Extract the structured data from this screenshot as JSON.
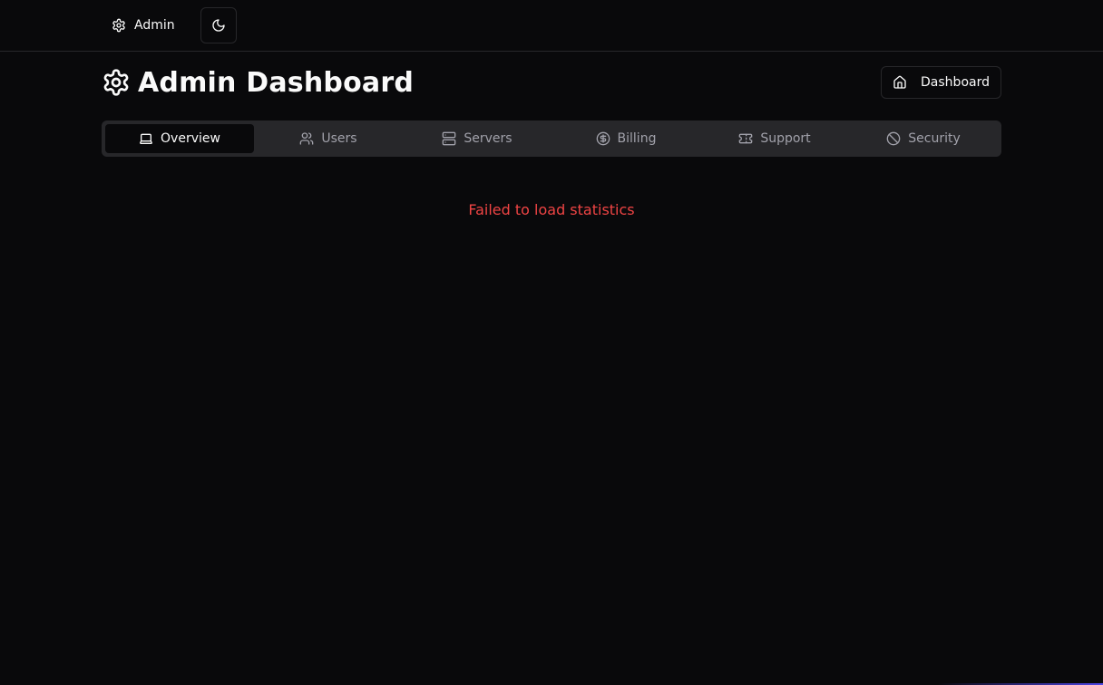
{
  "topbar": {
    "admin_label": "Admin",
    "admin_icon": "gear-icon",
    "theme_icon": "moon-icon"
  },
  "header": {
    "title": "Admin Dashboard",
    "title_icon": "gear-icon",
    "dashboard_button": "Dashboard",
    "dashboard_icon": "home-icon"
  },
  "tabs": [
    {
      "label": "Overview",
      "icon": "laptop-icon",
      "active": true
    },
    {
      "label": "Users",
      "icon": "users-icon",
      "active": false
    },
    {
      "label": "Servers",
      "icon": "server-icon",
      "active": false
    },
    {
      "label": "Billing",
      "icon": "dollar-circle-icon",
      "active": false
    },
    {
      "label": "Support",
      "icon": "ticket-icon",
      "active": false
    },
    {
      "label": "Security",
      "icon": "ban-icon",
      "active": false
    }
  ],
  "main": {
    "error_message": "Failed to load statistics"
  },
  "colors": {
    "background": "#09090b",
    "border": "#27272a",
    "muted_text": "#a1a1aa",
    "error": "#ef4444"
  }
}
